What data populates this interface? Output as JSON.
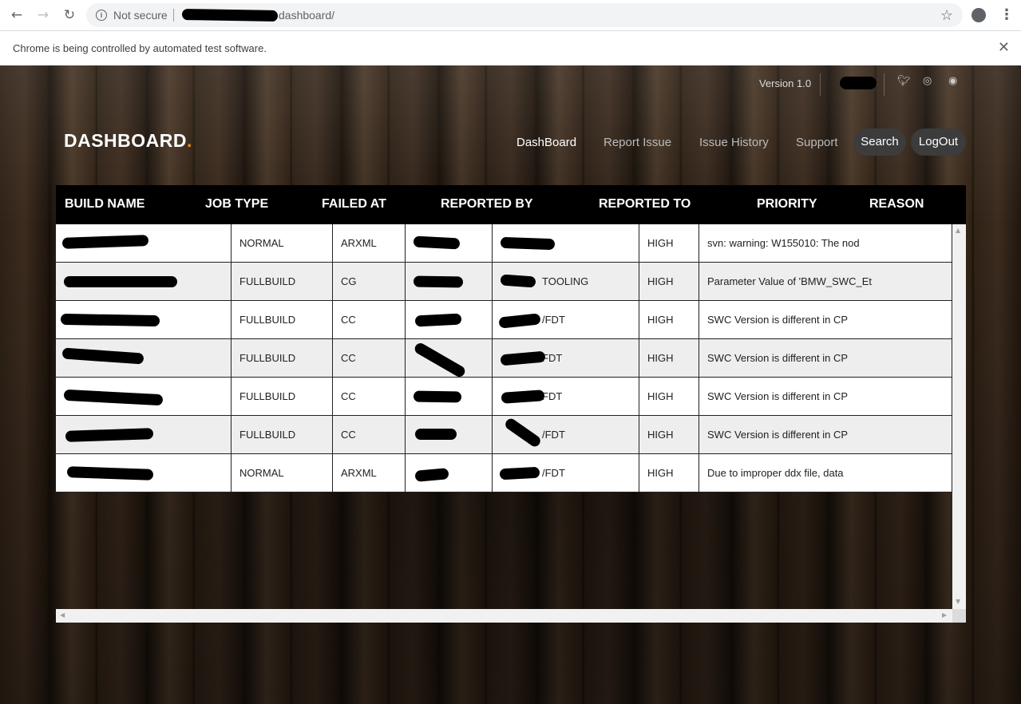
{
  "browser": {
    "security_label": "Not secure",
    "url_path": "dashboard/",
    "infobar_text": "Chrome is being controlled by automated test software."
  },
  "header": {
    "version": "Version 1.0",
    "brand": "DASHBOARD",
    "brand_dot": ".",
    "nav": [
      "DashBoard",
      "Report Issue",
      "Issue History",
      "Support"
    ],
    "search_label": "Search",
    "logout_label": "LogOut",
    "social_icons": [
      "twitter-icon",
      "dribbble-icon",
      "github-icon"
    ]
  },
  "table": {
    "columns": [
      "BUILD NAME",
      "JOB TYPE",
      "FAILED AT",
      "REPORTED BY",
      "REPORTED TO",
      "PRIORITY",
      "REASON"
    ],
    "rows": [
      {
        "job_type": "NORMAL",
        "failed_at": "ARXML",
        "reported_to_suffix": "",
        "priority": "HIGH",
        "reason": "svn: warning: W155010: The nod"
      },
      {
        "job_type": "FULLBUILD",
        "failed_at": "CG",
        "reported_to_suffix": "TOOLING",
        "priority": "HIGH",
        "reason": "Parameter Value of 'BMW_SWC_Et"
      },
      {
        "job_type": "FULLBUILD",
        "failed_at": "CC",
        "reported_to_suffix": "/FDT",
        "priority": "HIGH",
        "reason": "SWC Version is different in CP"
      },
      {
        "job_type": "FULLBUILD",
        "failed_at": "CC",
        "reported_to_suffix": "FDT",
        "priority": "HIGH",
        "reason": "SWC Version is different in CP"
      },
      {
        "job_type": "FULLBUILD",
        "failed_at": "CC",
        "reported_to_suffix": "FDT",
        "priority": "HIGH",
        "reason": "SWC Version is different in CP"
      },
      {
        "job_type": "FULLBUILD",
        "failed_at": "CC",
        "reported_to_suffix": "/FDT",
        "priority": "HIGH",
        "reason": "SWC Version is different in CP"
      },
      {
        "job_type": "NORMAL",
        "failed_at": "ARXML",
        "reported_to_suffix": "/FDT",
        "priority": "HIGH",
        "reason": "Due to improper ddx file, data"
      }
    ]
  },
  "colors": {
    "accent": "#e8891e",
    "header_bg": "#000000",
    "row_alt": "#eeeeee"
  }
}
